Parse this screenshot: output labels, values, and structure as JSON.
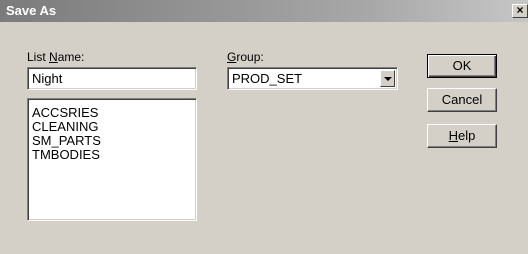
{
  "dialog": {
    "title": "Save As",
    "close_glyph": "×"
  },
  "list_name": {
    "label_prefix": "List ",
    "label_mnemonic": "N",
    "label_suffix": "ame:",
    "value": "Night",
    "items": [
      "ACCSRIES",
      "CLEANING",
      "SM_PARTS",
      "TMBODIES"
    ]
  },
  "group": {
    "label_mnemonic": "G",
    "label_suffix": "roup:",
    "selected": "PROD_SET"
  },
  "buttons": {
    "ok": "OK",
    "cancel": "Cancel",
    "help_mnemonic": "H",
    "help_suffix": "elp"
  },
  "icons": {
    "close": "close-icon",
    "dropdown": "chevron-down-icon"
  }
}
